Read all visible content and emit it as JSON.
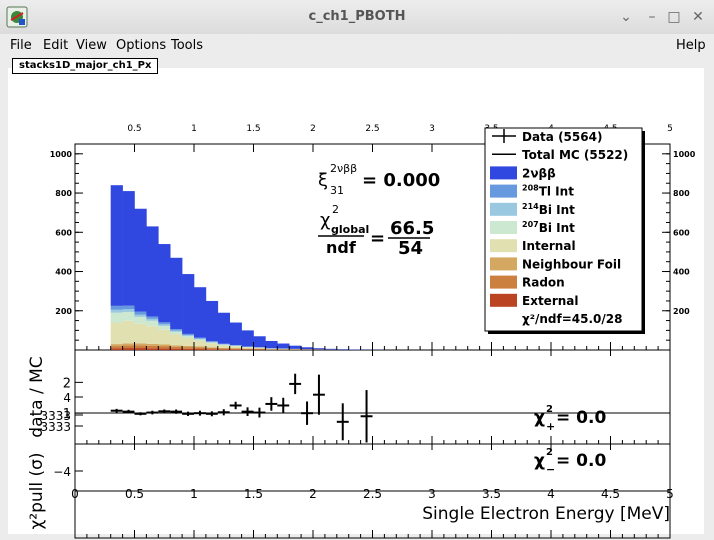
{
  "window": {
    "title": "c_ch1_PBOTH"
  },
  "menu": {
    "file": "File",
    "edit": "Edit",
    "view": "View",
    "options": "Options",
    "tools": "Tools",
    "help": "Help"
  },
  "canvas_tab": "stacks1D_major_ch1_Px",
  "colors": {
    "twonubb": "#3047e0",
    "tl208": "#6699dd",
    "bi214": "#99c8e0",
    "bi207": "#cce8d0",
    "internal": "#e0e0b0",
    "neighbour": "#d4a860",
    "radon": "#cc8040",
    "external": "#bb4422"
  },
  "top_panel": {
    "y_ticks": [
      "200",
      "400",
      "600",
      "800",
      "1000"
    ],
    "x_ticks_top": [
      "0.5",
      "1",
      "1.5",
      "2",
      "2.5",
      "3",
      "3.5",
      "4",
      "4.5",
      "5"
    ],
    "xi_symbol": "ξ",
    "xi_sup": "2νββ",
    "xi_sub": "31",
    "xi_value": "= 0.000",
    "chi_symbol": "χ",
    "chi_sup": "2",
    "chi_sub": "global",
    "ndf": "ndf",
    "equals": "=",
    "chi_num": "66.5",
    "ndf_den": "54"
  },
  "legend": [
    {
      "label": "Data (5564)",
      "style": "data"
    },
    {
      "label": "Total MC (5522)",
      "style": "line"
    },
    {
      "label": "2νββ",
      "style": "fill",
      "color": "#3047e0"
    },
    {
      "label": "Tl Int",
      "sup": "208",
      "style": "fill",
      "color": "#6699dd"
    },
    {
      "label": "Bi Int",
      "sup": "214",
      "style": "fill",
      "color": "#99c8e0"
    },
    {
      "label": "Bi Int",
      "sup": "207",
      "style": "fill",
      "color": "#cce8d0"
    },
    {
      "label": "Internal",
      "style": "fill",
      "color": "#e0e0b0"
    },
    {
      "label": "Neighbour Foil",
      "style": "fill",
      "color": "#d4a860"
    },
    {
      "label": "Radon",
      "style": "fill",
      "color": "#cc8040"
    },
    {
      "label": "External",
      "style": "fill",
      "color": "#bb4422"
    },
    {
      "label": "χ²/ndf=45.0/28",
      "style": "text"
    }
  ],
  "ratio_panel": {
    "ylabel": "data / MC",
    "y_ticks": [
      "1",
      "2"
    ]
  },
  "pull_panel": {
    "ylabel": "χ²pull (σ)",
    "y_ticks": [
      "4",
      ".3333",
      ".3333",
      "−4"
    ],
    "chi_plus": "χ",
    "chi_plus_sup": "2",
    "chi_plus_sub": "+",
    "chi_plus_value": "= 0.0",
    "chi_minus": "χ",
    "chi_minus_sup": "2",
    "chi_minus_sub": "−",
    "chi_minus_value": "= 0.0"
  },
  "x_axis": {
    "label": "Single Electron Energy [MeV]",
    "ticks": [
      "0",
      "0.5",
      "1",
      "1.5",
      "2",
      "2.5",
      "3",
      "3.5",
      "4",
      "4.5",
      "5"
    ]
  },
  "chart_data": {
    "type": "bar",
    "stacked": true,
    "xlabel": "Single Electron Energy [MeV]",
    "ylabel": "",
    "xlim": [
      0,
      5
    ],
    "ylim": [
      0,
      1050
    ],
    "bin_width": 0.1,
    "bin_edges_start": 0.3,
    "series": [
      {
        "name": "External",
        "color": "#bb4422",
        "values": [
          8,
          10,
          10,
          9,
          8,
          7,
          6,
          5,
          4,
          3,
          3,
          2,
          2,
          1,
          1,
          1,
          1,
          1,
          0,
          0,
          0,
          0,
          0,
          0,
          0,
          0,
          0
        ]
      },
      {
        "name": "Radon",
        "color": "#cc8040",
        "values": [
          12,
          14,
          14,
          13,
          12,
          10,
          9,
          8,
          6,
          5,
          4,
          3,
          3,
          2,
          2,
          1,
          1,
          1,
          1,
          0,
          0,
          0,
          0,
          0,
          0,
          0,
          0
        ]
      },
      {
        "name": "Neighbour Foil",
        "color": "#d4a860",
        "values": [
          10,
          10,
          10,
          9,
          8,
          7,
          6,
          5,
          4,
          3,
          3,
          2,
          2,
          1,
          1,
          1,
          1,
          0,
          0,
          0,
          0,
          0,
          0,
          0,
          0,
          0,
          0
        ]
      },
      {
        "name": "Internal",
        "color": "#e0e0b0",
        "values": [
          110,
          115,
          100,
          90,
          75,
          55,
          40,
          30,
          20,
          14,
          10,
          7,
          5,
          3,
          2,
          2,
          1,
          1,
          1,
          1,
          0,
          0,
          0,
          0,
          0,
          0,
          0
        ]
      },
      {
        "name": "207Bi Int",
        "color": "#cce8d0",
        "values": [
          50,
          45,
          35,
          28,
          20,
          14,
          10,
          6,
          4,
          2,
          1,
          1,
          0,
          0,
          0,
          0,
          0,
          0,
          0,
          0,
          0,
          0,
          0,
          0,
          0,
          0,
          0
        ]
      },
      {
        "name": "214Bi Int",
        "color": "#99c8e0",
        "values": [
          15,
          14,
          12,
          10,
          8,
          6,
          5,
          4,
          3,
          2,
          2,
          1,
          1,
          1,
          1,
          0,
          0,
          0,
          0,
          0,
          0,
          0,
          0,
          0,
          0,
          0,
          0
        ]
      },
      {
        "name": "208Tl Int",
        "color": "#6699dd",
        "values": [
          20,
          18,
          15,
          12,
          10,
          8,
          6,
          5,
          4,
          3,
          2,
          2,
          1,
          1,
          1,
          1,
          0,
          0,
          0,
          0,
          0,
          0,
          0,
          0,
          0,
          0,
          0
        ]
      },
      {
        "name": "2νββ",
        "color": "#3047e0",
        "values": [
          615,
          584,
          524,
          459,
          399,
          363,
          305,
          257,
          205,
          158,
          115,
          82,
          56,
          37,
          25,
          16,
          10,
          6,
          4,
          3,
          2,
          1,
          1,
          0,
          0,
          0,
          0
        ]
      }
    ],
    "ratio_points": [
      {
        "x": 0.35,
        "y": 1.08,
        "err": 0.06
      },
      {
        "x": 0.45,
        "y": 1.05,
        "err": 0.06
      },
      {
        "x": 0.55,
        "y": 0.98,
        "err": 0.05
      },
      {
        "x": 0.65,
        "y": 1.02,
        "err": 0.06
      },
      {
        "x": 0.75,
        "y": 1.06,
        "err": 0.06
      },
      {
        "x": 0.85,
        "y": 1.05,
        "err": 0.07
      },
      {
        "x": 0.95,
        "y": 0.98,
        "err": 0.07
      },
      {
        "x": 1.05,
        "y": 1.0,
        "err": 0.08
      },
      {
        "x": 1.15,
        "y": 0.98,
        "err": 0.08
      },
      {
        "x": 1.25,
        "y": 1.03,
        "err": 0.1
      },
      {
        "x": 1.35,
        "y": 1.25,
        "err": 0.12
      },
      {
        "x": 1.45,
        "y": 1.05,
        "err": 0.14
      },
      {
        "x": 1.55,
        "y": 1.02,
        "err": 0.16
      },
      {
        "x": 1.65,
        "y": 1.3,
        "err": 0.22
      },
      {
        "x": 1.75,
        "y": 1.25,
        "err": 0.25
      },
      {
        "x": 1.85,
        "y": 1.95,
        "err": 0.33
      },
      {
        "x": 1.95,
        "y": 1.0,
        "err": 0.38
      },
      {
        "x": 2.05,
        "y": 1.6,
        "err": 0.65
      },
      {
        "x": 2.25,
        "y": 0.72,
        "err": 0.6
      },
      {
        "x": 2.45,
        "y": 0.9,
        "err": 0.85
      }
    ],
    "ratio_ylim": [
      0,
      3.05
    ]
  }
}
